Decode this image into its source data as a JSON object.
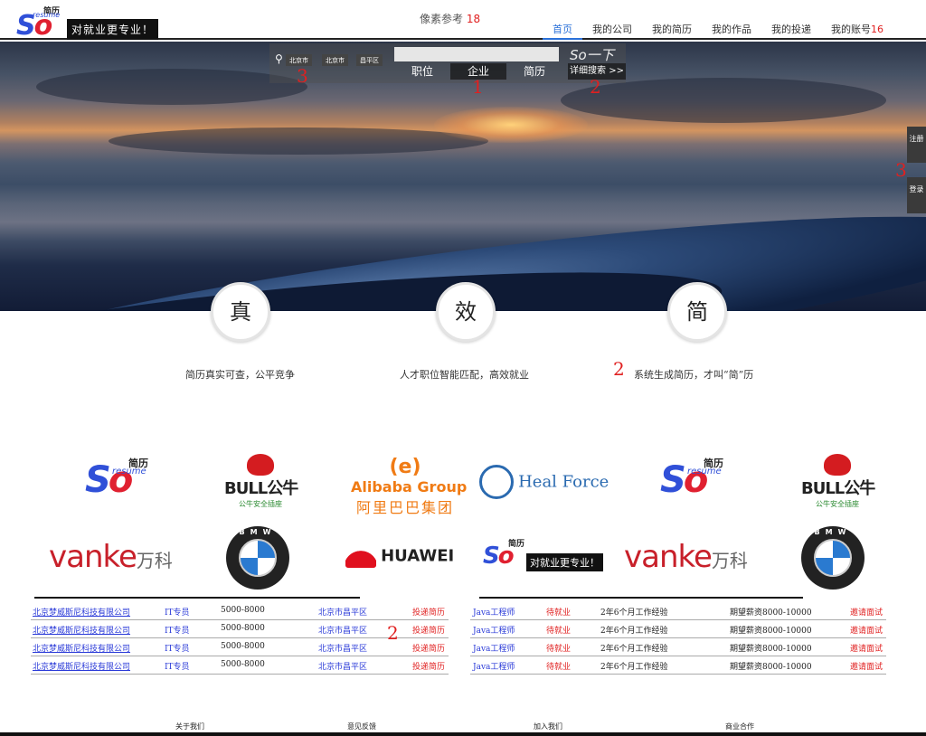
{
  "header": {
    "logo": {
      "so": "So",
      "jianli": "简历",
      "resume": "resume",
      "slogan": "对就业更专业！"
    },
    "pixel_ref_label": "像素参考",
    "pixel_ref_value": "18",
    "nav": [
      "首页",
      "我的公司",
      "我的简历",
      "我的作品",
      "我的投递",
      "我的账号"
    ],
    "nav_active": "首页",
    "nav_annotation": "16"
  },
  "search": {
    "locations": [
      "北京市",
      "北京市",
      "昌平区"
    ],
    "input_value": "",
    "so_button": "So一下",
    "tabs": [
      "职位",
      "企业",
      "简历"
    ],
    "active_tab": "企业",
    "advanced": "详细搜索 >>"
  },
  "annotations": {
    "loc": "3",
    "tabs": "1",
    "adv": "2",
    "side": "3",
    "feature": "2",
    "table": "2"
  },
  "side_buttons": [
    "注册",
    "登录"
  ],
  "features": [
    {
      "char": "真",
      "text": "简历真实可查，公平竞争"
    },
    {
      "char": "效",
      "text": "人才职位智能匹配，高效就业"
    },
    {
      "char": "简",
      "text": "系统生成简历，才叫“简”历"
    }
  ],
  "brands": {
    "so": {
      "so": "So",
      "jianli": "简历",
      "resume": "resume",
      "slogan": "对就业更专业！"
    },
    "bull": {
      "name": "BULL公牛",
      "sub": "公牛安全插座"
    },
    "alibaba": {
      "name": "Alibaba Group",
      "cn": "阿里巴巴集团"
    },
    "healforce": "Heal Force",
    "vanke": {
      "name": "vanke",
      "cn": "万科"
    },
    "bmw": "BMW",
    "huawei": "HUAWEI"
  },
  "jobs_left": [
    {
      "company": "北京梦威斯尼科技有限公司",
      "position": "IT专员",
      "salary": "5000-8000",
      "location": "北京市昌平区",
      "action": "投递简历"
    },
    {
      "company": "北京梦威斯尼科技有限公司",
      "position": "IT专员",
      "salary": "5000-8000",
      "location": "北京市昌平区",
      "action": "投递简历"
    },
    {
      "company": "北京梦威斯尼科技有限公司",
      "position": "IT专员",
      "salary": "5000-8000",
      "location": "北京市昌平区",
      "action": "投递简历"
    },
    {
      "company": "北京梦威斯尼科技有限公司",
      "position": "IT专员",
      "salary": "5000-8000",
      "location": "北京市昌平区",
      "action": "投递简历"
    }
  ],
  "jobs_right": [
    {
      "title": "Java工程师",
      "status": "待就业",
      "experience": "2年6个月工作经验",
      "salary": "期望薪资8000-10000",
      "action": "邀请面试"
    },
    {
      "title": "Java工程师",
      "status": "待就业",
      "experience": "2年6个月工作经验",
      "salary": "期望薪资8000-10000",
      "action": "邀请面试"
    },
    {
      "title": "Java工程师",
      "status": "待就业",
      "experience": "2年6个月工作经验",
      "salary": "期望薪资8000-10000",
      "action": "邀请面试"
    },
    {
      "title": "Java工程师",
      "status": "待就业",
      "experience": "2年6个月工作经验",
      "salary": "期望薪资8000-10000",
      "action": "邀请面试"
    }
  ],
  "footer": [
    "关于我们",
    "意见反馈",
    "加入我们",
    "商业合作"
  ],
  "colors": {
    "accent": "#2a70d8",
    "annotation": "#e02020",
    "link_blue": "#2a3ad8",
    "logo_blue": "#3050d8",
    "logo_red": "#e02030"
  }
}
